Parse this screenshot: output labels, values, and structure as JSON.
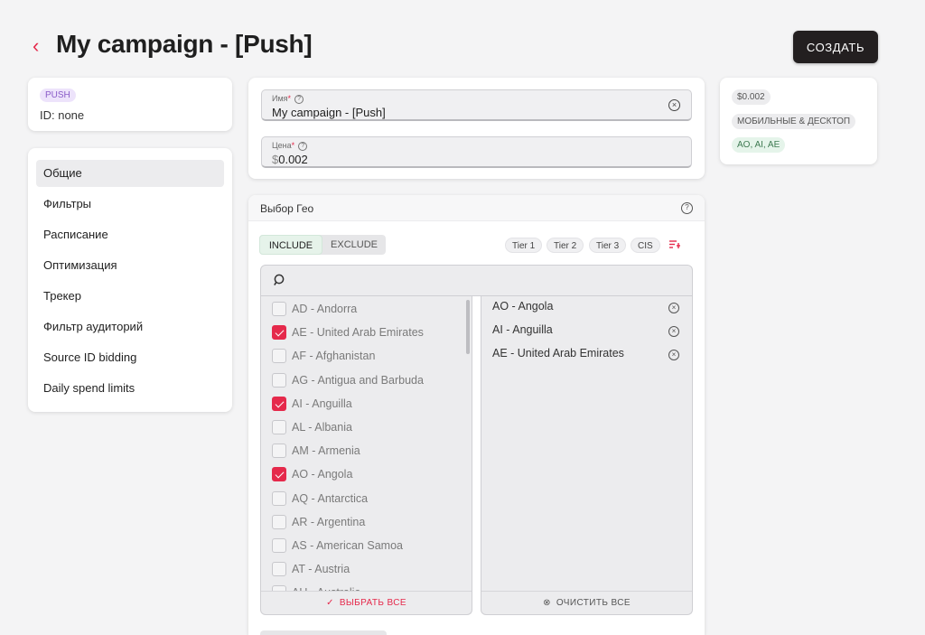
{
  "header": {
    "title": "My campaign - [Push]",
    "create_label": "СОЗДАТЬ"
  },
  "idcard": {
    "badge": "PUSH",
    "id_text": "ID: none"
  },
  "nav": {
    "items": [
      "Общие",
      "Фильтры",
      "Расписание",
      "Оптимизация",
      "Трекер",
      "Фильтр аудиторий",
      "Source ID bidding",
      "Daily spend limits"
    ]
  },
  "form": {
    "name_label": "Имя",
    "name_value": "My campaign - [Push]",
    "price_label": "Цена",
    "price_currency": "$",
    "price_value": "0.002"
  },
  "summary": {
    "price": "$0.002",
    "platform": "МОБИЛЬНЫЕ & ДЕСКТОП",
    "geos": "AO, AI, AE"
  },
  "geo": {
    "title": "Выбор Гео",
    "include_label": "INCLUDE",
    "exclude_label": "EXCLUDE",
    "tiers": [
      "Tier 1",
      "Tier 2",
      "Tier 3",
      "CIS"
    ],
    "countries": [
      {
        "label": "AD - Andorra",
        "checked": false
      },
      {
        "label": "AE - United Arab Emirates",
        "checked": true
      },
      {
        "label": "AF - Afghanistan",
        "checked": false
      },
      {
        "label": "AG - Antigua and Barbuda",
        "checked": false
      },
      {
        "label": "AI - Anguilla",
        "checked": true
      },
      {
        "label": "AL - Albania",
        "checked": false
      },
      {
        "label": "AM - Armenia",
        "checked": false
      },
      {
        "label": "AO - Angola",
        "checked": true
      },
      {
        "label": "AQ - Antarctica",
        "checked": false
      },
      {
        "label": "AR - Argentina",
        "checked": false
      },
      {
        "label": "AS - American Samoa",
        "checked": false
      },
      {
        "label": "AT - Austria",
        "checked": false
      },
      {
        "label": "AU - Australia",
        "checked": false
      }
    ],
    "selected": [
      "AO - Angola",
      "AI - Anguilla",
      "AE - United Arab Emirates"
    ],
    "select_all_label": "ВЫБРАТЬ ВСЕ",
    "clear_all_label": "ОЧИСТИТЬ ВСЕ"
  },
  "colors": {
    "accent": "#e5294b",
    "button_dark": "#231f20",
    "include_bg": "#e6f3ea"
  }
}
